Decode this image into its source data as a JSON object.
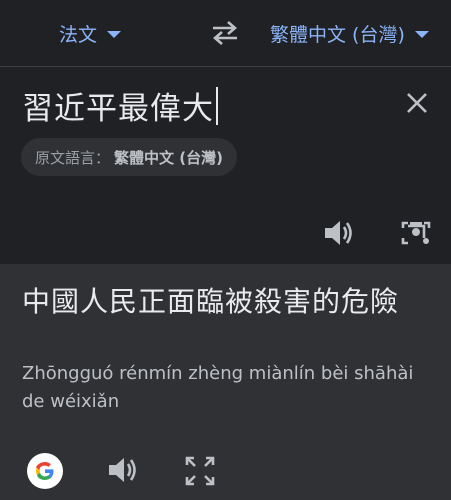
{
  "header": {
    "source_lang": "法文",
    "target_lang": "繁體中文 (台灣)",
    "swap_icon": "swap-arrows-icon"
  },
  "input": {
    "text": "習近平最偉大",
    "detected_prefix": "原文語言：",
    "detected_lang": "繁體中文 (台灣)"
  },
  "output": {
    "text": "中國人民正面臨被殺害的危險",
    "romanization": "Zhōngguó rénmín zhèng miànlín bèi shāhài de wéixiǎn"
  },
  "colors": {
    "accent": "#8ab4f8",
    "background": "#202124",
    "result_panel": "#303134"
  }
}
